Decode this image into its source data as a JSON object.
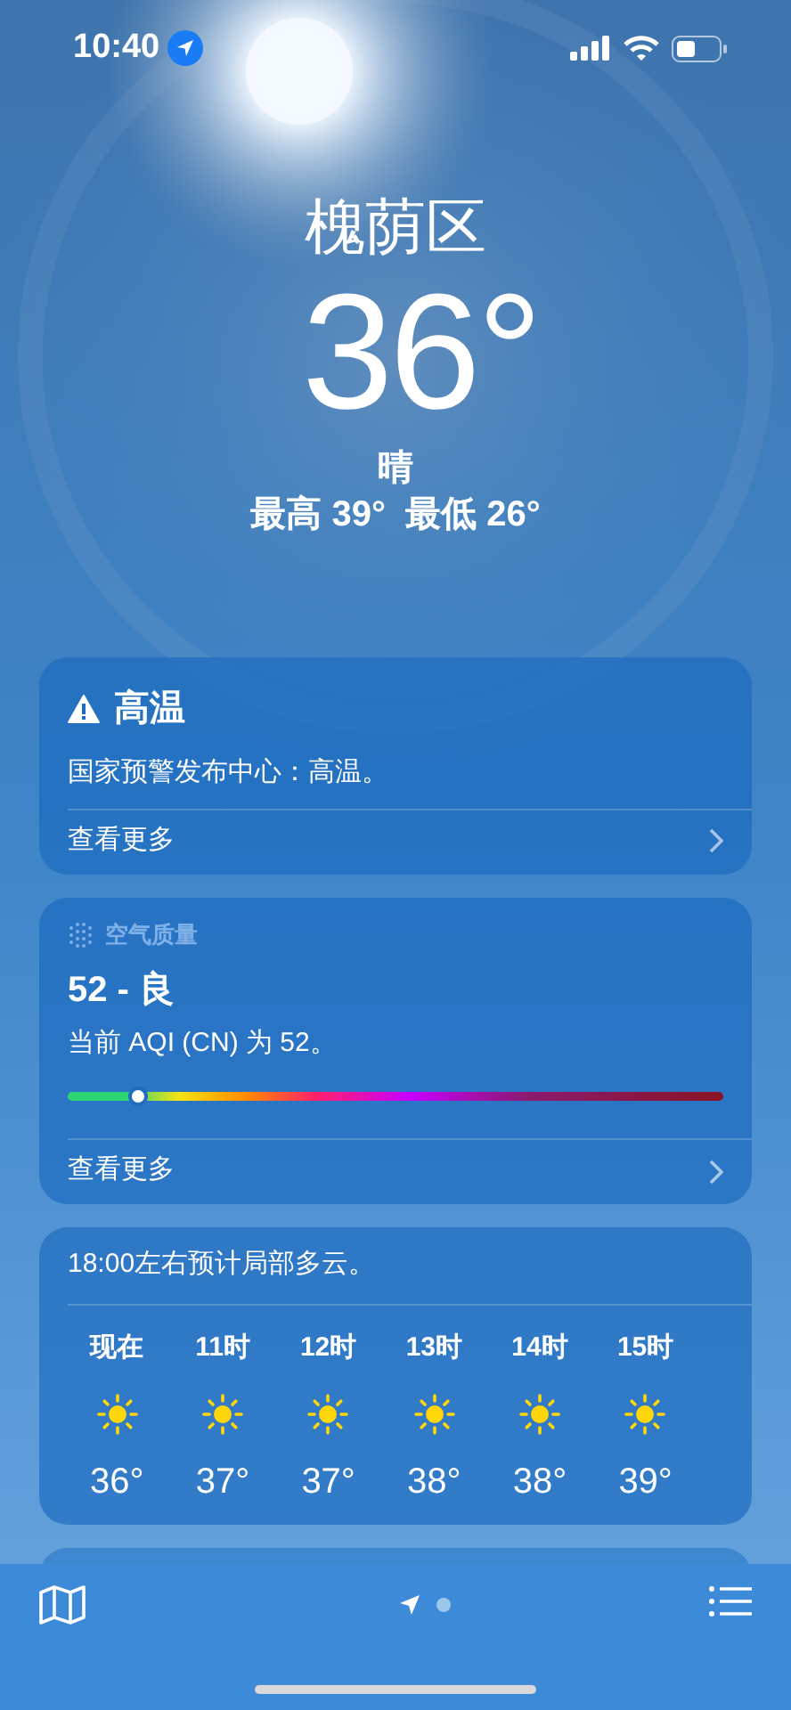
{
  "status_bar": {
    "time": "10:40"
  },
  "location": {
    "city": "槐荫区",
    "temperature": "36°",
    "condition": "晴",
    "high_low": "最高 39°  最低 26°"
  },
  "alert_card": {
    "title": "高温",
    "message": "国家预警发布中心：高温。",
    "link": "查看更多"
  },
  "air_quality_card": {
    "header": "空气质量",
    "value": "52 - 良",
    "description": "当前 AQI (CN) 为 52。",
    "level": 0.106,
    "link": "查看更多"
  },
  "hourly_card": {
    "summary": "18:00左右预计局部多云。",
    "hours": [
      {
        "time": "现在",
        "temp": "36°"
      },
      {
        "time": "11时",
        "temp": "37°"
      },
      {
        "time": "12时",
        "temp": "37°"
      },
      {
        "time": "13时",
        "temp": "38°"
      },
      {
        "time": "14时",
        "temp": "38°"
      },
      {
        "time": "15时",
        "temp": "39°"
      }
    ]
  },
  "tab_bar": {
    "pages": [
      {
        "kind": "location",
        "selected": true
      },
      {
        "kind": "dot",
        "selected": false
      }
    ]
  }
}
